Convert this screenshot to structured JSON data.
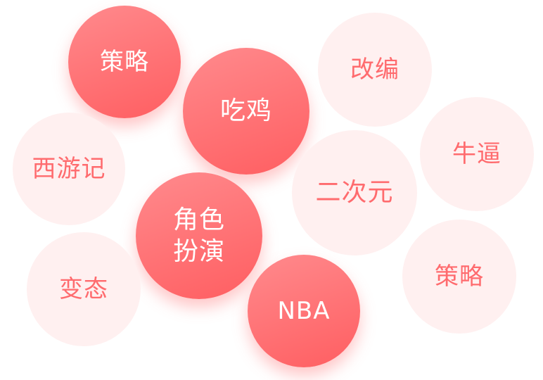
{
  "colors": {
    "selected_gradient_start": "#ff8a8d",
    "selected_gradient_end": "#ff5e61",
    "selected_text": "#ffffff",
    "unselected_fill": "#fff0f0",
    "unselected_text": "#ff6b6e"
  },
  "tags": [
    {
      "id": "celue1",
      "label": "策略",
      "selected": true
    },
    {
      "id": "chiji",
      "label": "吃鸡",
      "selected": true
    },
    {
      "id": "gaibian",
      "label": "改编",
      "selected": false
    },
    {
      "id": "xiyouji",
      "label": "西游记",
      "selected": false
    },
    {
      "id": "niubi",
      "label": "牛逼",
      "selected": false
    },
    {
      "id": "erciyuan",
      "label": "二次元",
      "selected": false
    },
    {
      "id": "juese",
      "label": "角色\n扮演",
      "selected": true
    },
    {
      "id": "biantai",
      "label": "变态",
      "selected": false
    },
    {
      "id": "celue2",
      "label": "策略",
      "selected": false
    },
    {
      "id": "nba",
      "label": "NBA",
      "selected": true
    }
  ]
}
